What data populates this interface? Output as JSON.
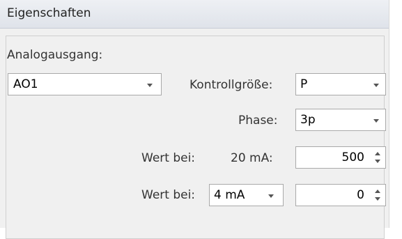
{
  "panel": {
    "title": "Eigenschaften"
  },
  "analog_output": {
    "label": "Analogausgang:",
    "selected": "AO1"
  },
  "control_variable": {
    "label": "Kontrollgröße:",
    "selected": "P"
  },
  "phase": {
    "label": "Phase:",
    "selected": "3p"
  },
  "value_at_20ma": {
    "label": "Wert bei:",
    "current_label": "20 mA:",
    "value": "500"
  },
  "value_at_4ma": {
    "label": "Wert bei:",
    "current_selected": "4 mA",
    "value": "0"
  }
}
